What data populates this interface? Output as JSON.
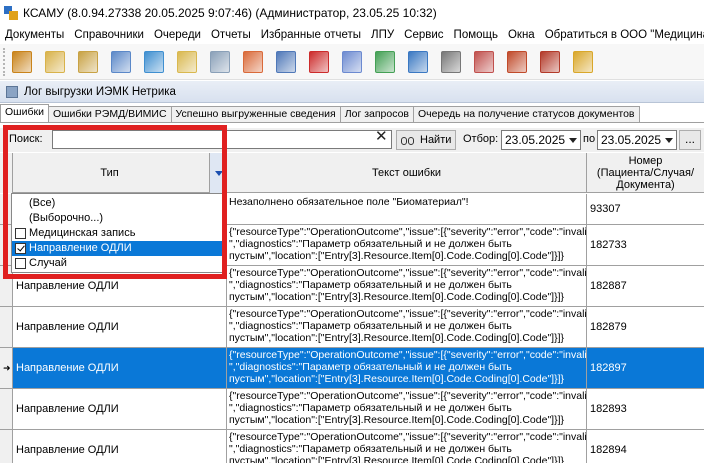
{
  "window": {
    "title": "КСАМУ (8.0.94.27338 20.05.2025 9:07:46) (Администратор, 23.05.25 10:32)"
  },
  "menu": [
    "Документы",
    "Справочники",
    "Очереди",
    "Отчеты",
    "Избранные отчеты",
    "ЛПУ",
    "Сервис",
    "Помощь",
    "Окна",
    "Обратиться в ООО \"Медицина\""
  ],
  "toolbar": [
    {
      "icon": "pencil-tool-icon",
      "color": "#c9831a"
    },
    {
      "icon": "list-card-icon",
      "color": "#d8b24a"
    },
    {
      "icon": "journal-icon",
      "color": "#c8a244"
    },
    {
      "icon": "id-card-icon",
      "color": "#5b88c8"
    },
    {
      "icon": "lab-flask-icon",
      "color": "#3f8fd0"
    },
    {
      "icon": "notes-icon",
      "color": "#d9b84f"
    },
    {
      "icon": "syringe-icon",
      "color": "#8aa0b8"
    },
    {
      "icon": "patient-card-icon",
      "color": "#d96a3a"
    },
    {
      "icon": "shield-icon",
      "color": "#4f78b8"
    },
    {
      "icon": "medical-kit-icon",
      "color": "#cc2b2b"
    },
    {
      "icon": "documents-icon",
      "color": "#6c8ad0"
    },
    {
      "icon": "pills-icon",
      "color": "#44a055"
    },
    {
      "icon": "globe-icon",
      "color": "#3a78c2"
    },
    {
      "icon": "scanner-icon",
      "color": "#777777"
    },
    {
      "icon": "nurse-icon",
      "color": "#c0504d"
    },
    {
      "icon": "cabinet-icon",
      "color": "#c04a2a"
    },
    {
      "icon": "folders-icon",
      "color": "#b33a2a"
    },
    {
      "icon": "lock-icon",
      "color": "#d9a72a"
    }
  ],
  "inner_window": {
    "title": "Лог выгрузки ИЭМК Нетрика"
  },
  "tabs": [
    "Ошибки",
    "Ошибки РЭМД/ВИМИС",
    "Успешно выгруженные сведения",
    "Лог запросов",
    "Очередь на получение статусов документов"
  ],
  "search": {
    "label": "Поиск:",
    "value": "",
    "clear": "✕",
    "find_label": "Найти",
    "select_label": "Отбор:",
    "date_from": "23.05.2025",
    "to_label": "по",
    "date_to": "23.05.2025",
    "more": "..."
  },
  "columns": {
    "type": "Тип",
    "text": "Текст ошибки",
    "number": "Номер\n(Пациента/Случая/Документа)"
  },
  "rows": [
    {
      "type": "",
      "text": "Незаполнено обязательное поле \"Биоматериал\"!",
      "number": "93307",
      "selected": false,
      "current": false
    },
    {
      "type": "",
      "text": "{\"resourceType\":\"OperationOutcome\",\"issue\":[{\"severity\":\"error\",\"code\":\"invalid\n\",\"diagnostics\":\"Параметр обязательный и не должен быть\nпустым\",\"location\":[\"Entry[3].Resource.Item[0].Code.Coding[0].Code\"]}]}",
      "number": "182733",
      "selected": false,
      "current": false
    },
    {
      "type": "Направление ОДЛИ",
      "text": "{\"resourceType\":\"OperationOutcome\",\"issue\":[{\"severity\":\"error\",\"code\":\"invalid\n\",\"diagnostics\":\"Параметр обязательный и не должен быть\nпустым\",\"location\":[\"Entry[3].Resource.Item[0].Code.Coding[0].Code\"]}]}",
      "number": "182887",
      "selected": false,
      "current": false
    },
    {
      "type": "Направление ОДЛИ",
      "text": "{\"resourceType\":\"OperationOutcome\",\"issue\":[{\"severity\":\"error\",\"code\":\"invalid\n\",\"diagnostics\":\"Параметр обязательный и не должен быть\nпустым\",\"location\":[\"Entry[3].Resource.Item[0].Code.Coding[0].Code\"]}]}",
      "number": "182879",
      "selected": false,
      "current": false
    },
    {
      "type": "Направление ОДЛИ",
      "text": "{\"resourceType\":\"OperationOutcome\",\"issue\":[{\"severity\":\"error\",\"code\":\"invalid\n\",\"diagnostics\":\"Параметр обязательный и не должен быть\nпустым\",\"location\":[\"Entry[3].Resource.Item[0].Code.Coding[0].Code\"]}]}",
      "number": "182897",
      "selected": true,
      "current": true
    },
    {
      "type": "Направление ОДЛИ",
      "text": "{\"resourceType\":\"OperationOutcome\",\"issue\":[{\"severity\":\"error\",\"code\":\"invalid\n\",\"diagnostics\":\"Параметр обязательный и не должен быть\nпустым\",\"location\":[\"Entry[3].Resource.Item[0].Code.Coding[0].Code\"]}]}",
      "number": "182893",
      "selected": false,
      "current": false
    },
    {
      "type": "Направление ОДЛИ",
      "text": "{\"resourceType\":\"OperationOutcome\",\"issue\":[{\"severity\":\"error\",\"code\":\"invalid\n\",\"diagnostics\":\"Параметр обязательный и не должен быть\nпустым\",\"location\":[\"Entry[3].Resource.Item[0].Code.Coding[0].Code\"]}]}",
      "number": "182894",
      "selected": false,
      "current": false
    }
  ],
  "filter_dropdown": {
    "items": [
      {
        "label": "(Все)",
        "checkbox": false,
        "checked": false,
        "highlighted": false
      },
      {
        "label": "(Выборочно...)",
        "checkbox": false,
        "checked": false,
        "highlighted": false
      },
      {
        "label": "Медицинская запись",
        "checkbox": true,
        "checked": false,
        "highlighted": false
      },
      {
        "label": "Направление ОДЛИ",
        "checkbox": true,
        "checked": true,
        "highlighted": true
      },
      {
        "label": "Случай",
        "checkbox": true,
        "checked": false,
        "highlighted": false
      }
    ]
  },
  "colors": {
    "selection": "#0a78d7",
    "highlight_box": "#e02020"
  }
}
